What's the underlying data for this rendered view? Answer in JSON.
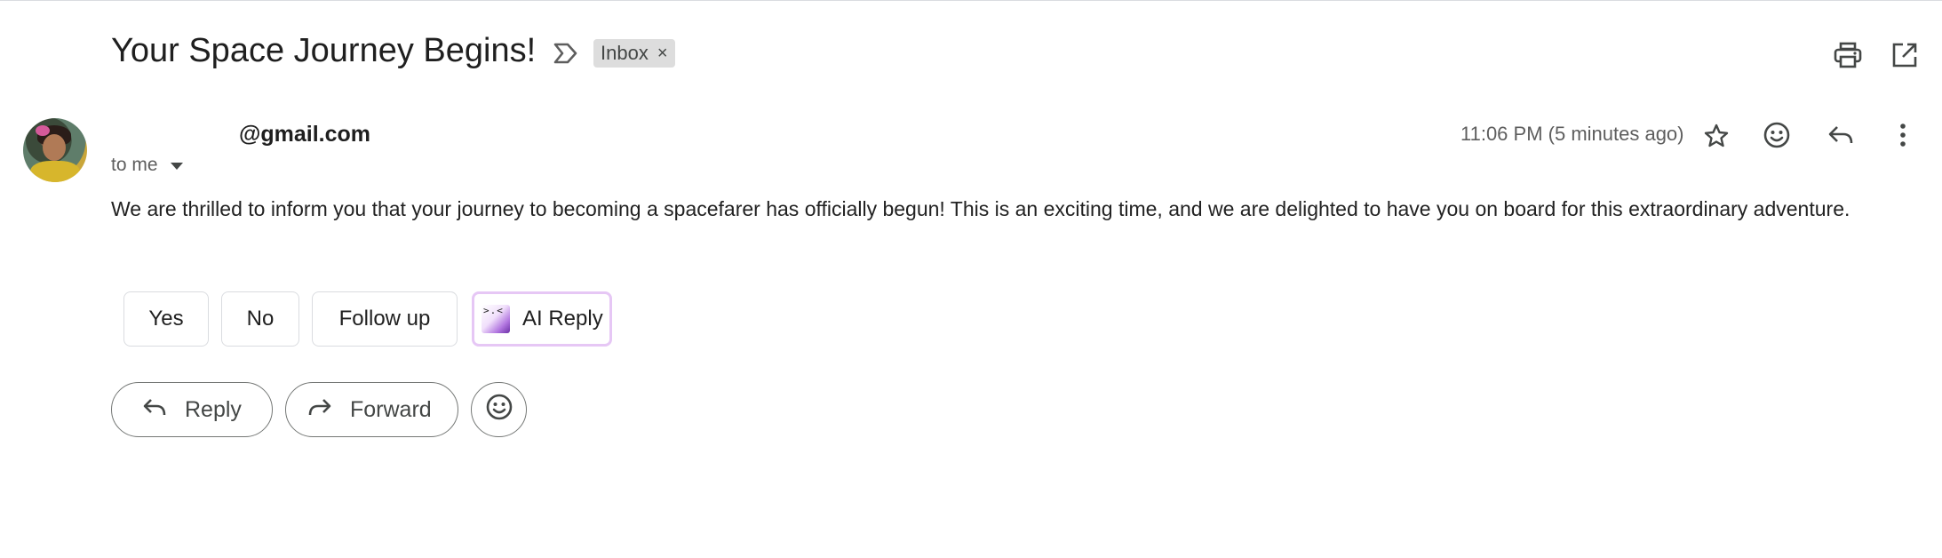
{
  "email": {
    "subject": "Your Space Journey Begins!",
    "label_chip": "Inbox",
    "label_remove": "×",
    "sender_email": "@gmail.com",
    "recipient_text": "to me",
    "timestamp": "11:06 PM (5 minutes ago)",
    "body": "We are thrilled to inform you that your journey to becoming a spacefarer has officially begun! This is an exciting time, and we are delighted to have you on board for this extraordinary adventure."
  },
  "smart_replies": [
    "Yes",
    "No",
    "Follow up"
  ],
  "ai_reply": {
    "label": "AI Reply",
    "logo_text": ">.<"
  },
  "actions": {
    "reply": "Reply",
    "forward": "Forward"
  },
  "icons": {
    "header": [
      "label-icon",
      "print-icon",
      "open-in-new-window-icon"
    ],
    "message": [
      "star-icon",
      "emoji-icon",
      "reply-icon",
      "more-vertical-icon"
    ]
  },
  "colors": {
    "text": "#1f1f1f",
    "muted": "#5e5e5e",
    "chip_bg": "#dddddd",
    "ai_border": "#e6c7f5"
  }
}
